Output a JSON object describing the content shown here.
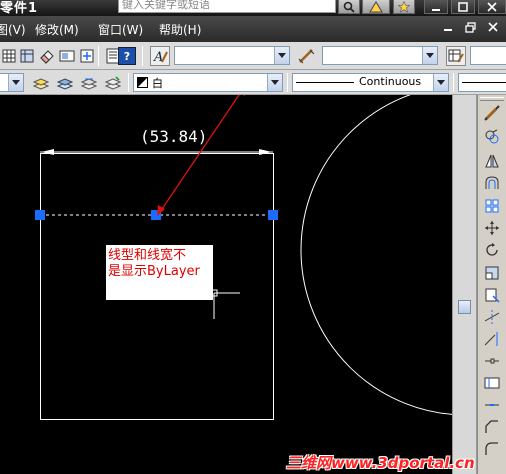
{
  "window": {
    "title": "零件1",
    "search_placeholder": "键入关键字或短语"
  },
  "menu": {
    "items": [
      {
        "label": "图(V)"
      },
      {
        "label": "修改(M)"
      },
      {
        "label": "窗口(W)"
      },
      {
        "label": "帮助(H)"
      }
    ]
  },
  "toolbar2": {
    "color_value": "白",
    "linetype_value": "Continuous"
  },
  "drawing": {
    "dimension_text": "(53.84)",
    "annotation_line1": "线型和线宽不",
    "annotation_line2": "是显示ByLayer"
  },
  "watermark": "三维网www.3dportal.cn",
  "colors": {
    "titlebar": "#2a2a2a",
    "toolbar": "#dcdcdc",
    "canvas": "#000000",
    "grip": "#1a6cff",
    "annotation_text": "#e00000",
    "leader_arrow": "#e01010"
  }
}
